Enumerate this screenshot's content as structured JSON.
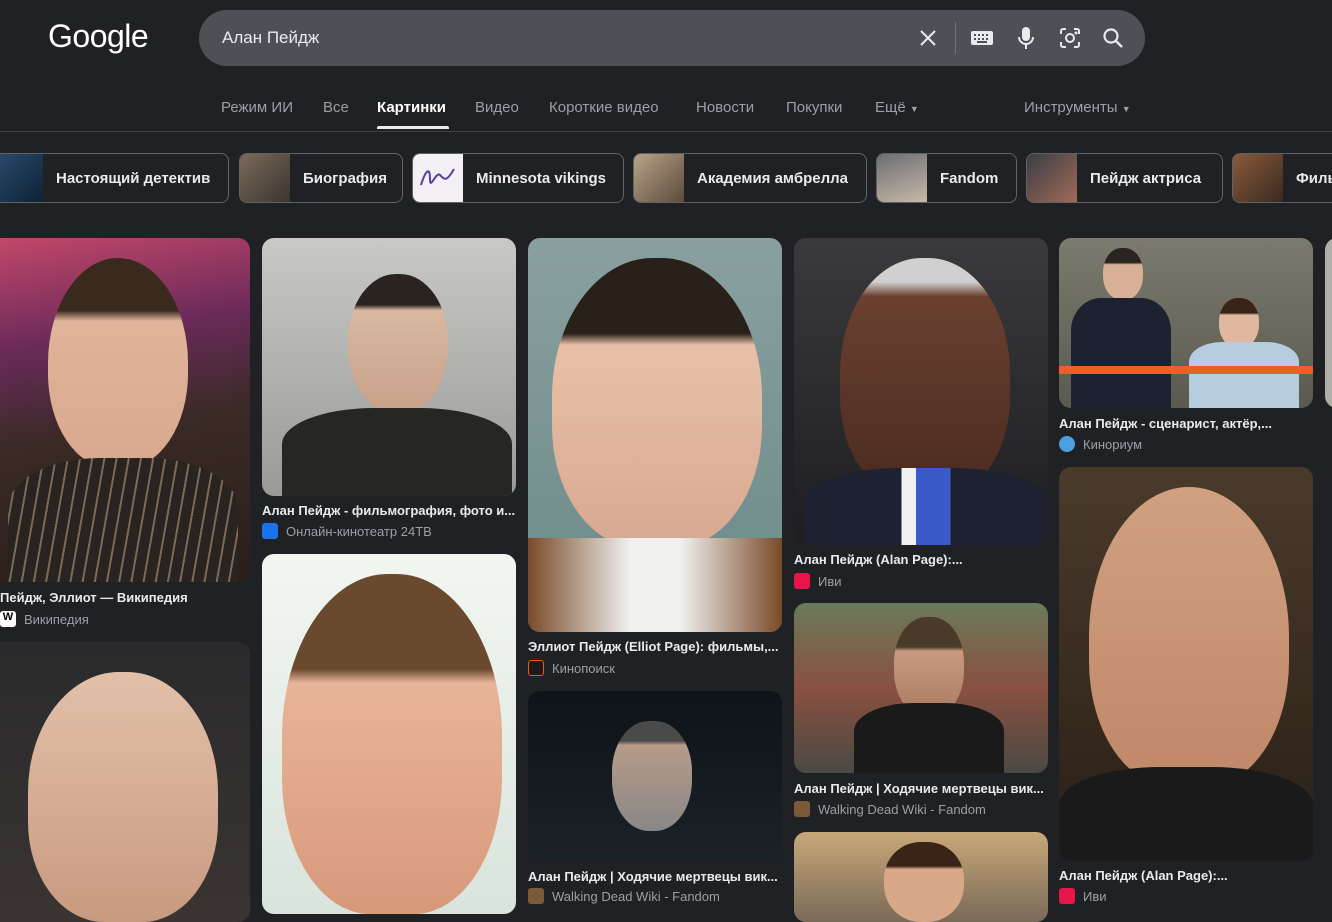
{
  "header": {
    "logo": "Google",
    "query": "Алан Пейдж"
  },
  "icons": [
    "close-icon",
    "keyboard-icon",
    "mic-icon",
    "lens-icon",
    "search-icon",
    "chevron-down-icon"
  ],
  "tabs": [
    {
      "label": "Режим ИИ"
    },
    {
      "label": "Все"
    },
    {
      "label": "Картинки"
    },
    {
      "label": "Видео"
    },
    {
      "label": "Короткие видео"
    },
    {
      "label": "Новости"
    },
    {
      "label": "Покупки"
    },
    {
      "label": "Ещё"
    }
  ],
  "tools_label": "Инструменты",
  "chips": [
    {
      "label": "Настоящий детектив"
    },
    {
      "label": "Биография"
    },
    {
      "label": "Minnesota vikings"
    },
    {
      "label": "Академия амбрелла"
    },
    {
      "label": "Fandom"
    },
    {
      "label": "Пейдж актриса"
    },
    {
      "label": "Филь"
    }
  ],
  "results": [
    {
      "title": "Пейдж, Эллиот — Википедия",
      "source": "Википедия"
    },
    {
      "title": "Алан Пейдж - фильмография, фото и...",
      "source": "Онлайн-кинотеатр 24ТВ"
    },
    {
      "title": "Эллиот Пейдж (Elliot Page): фильмы,...",
      "source": "Кинопоиск"
    },
    {
      "title": "Алан Пейдж | Ходячие мертвецы вик...",
      "source": "Walking Dead Wiki - Fandom"
    },
    {
      "title": "Алан Пейдж (Alan Page):...",
      "source": "Иви"
    },
    {
      "title": "Алан Пейдж | Ходячие мертвецы вик...",
      "source": "Walking Dead Wiki - Fandom"
    },
    {
      "title": "Алан Пейдж - сценарист, актёр,...",
      "source": "Кинориум"
    },
    {
      "title": "Алан Пейдж (Alan Page):...",
      "source": "Иви"
    }
  ],
  "colors": {
    "background": "#202124",
    "search_bg": "#4d5156",
    "text": "#e8eaed",
    "muted": "#9aa0a6"
  }
}
